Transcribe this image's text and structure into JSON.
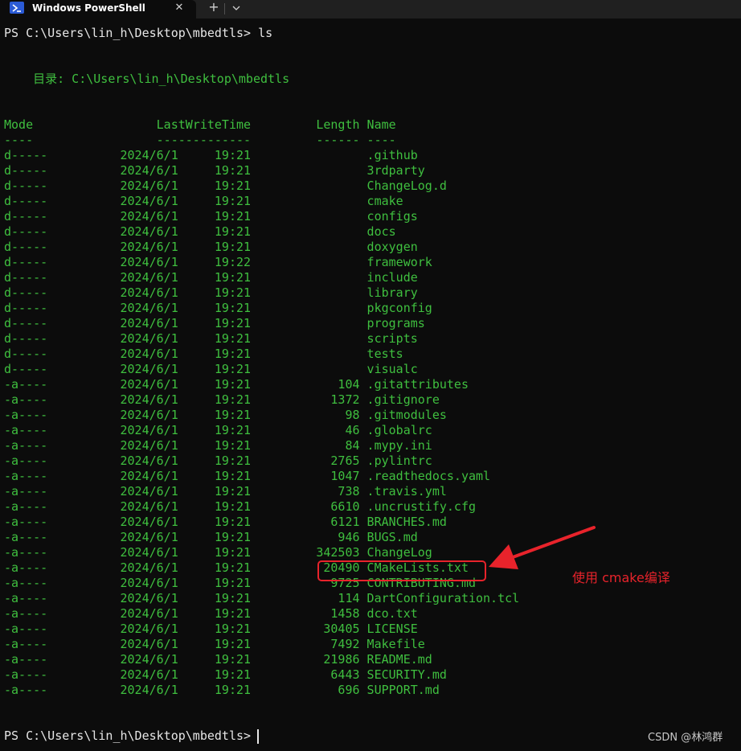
{
  "tab": {
    "title": "Windows PowerShell",
    "close_glyph": "✕",
    "new_tab_glyph": "+",
    "icon": "powershell-icon",
    "dropdown_icon": "chevron-down-icon"
  },
  "terminal": {
    "prompt1": "PS C:\\Users\\lin_h\\Desktop\\mbedtls> ls",
    "directory_line": "    目录: C:\\Users\\lin_h\\Desktop\\mbedtls",
    "header": "Mode                 LastWriteTime         Length Name",
    "header_underline": "----                 -------------         ------ ----",
    "entries": [
      "d-----          2024/6/1     19:21                .github",
      "d-----          2024/6/1     19:21                3rdparty",
      "d-----          2024/6/1     19:21                ChangeLog.d",
      "d-----          2024/6/1     19:21                cmake",
      "d-----          2024/6/1     19:21                configs",
      "d-----          2024/6/1     19:21                docs",
      "d-----          2024/6/1     19:21                doxygen",
      "d-----          2024/6/1     19:22                framework",
      "d-----          2024/6/1     19:21                include",
      "d-----          2024/6/1     19:21                library",
      "d-----          2024/6/1     19:21                pkgconfig",
      "d-----          2024/6/1     19:21                programs",
      "d-----          2024/6/1     19:21                scripts",
      "d-----          2024/6/1     19:21                tests",
      "d-----          2024/6/1     19:21                visualc",
      "-a----          2024/6/1     19:21            104 .gitattributes",
      "-a----          2024/6/1     19:21           1372 .gitignore",
      "-a----          2024/6/1     19:21             98 .gitmodules",
      "-a----          2024/6/1     19:21             46 .globalrc",
      "-a----          2024/6/1     19:21             84 .mypy.ini",
      "-a----          2024/6/1     19:21           2765 .pylintrc",
      "-a----          2024/6/1     19:21           1047 .readthedocs.yaml",
      "-a----          2024/6/1     19:21            738 .travis.yml",
      "-a----          2024/6/1     19:21           6610 .uncrustify.cfg",
      "-a----          2024/6/1     19:21           6121 BRANCHES.md",
      "-a----          2024/6/1     19:21            946 BUGS.md",
      "-a----          2024/6/1     19:21         342503 ChangeLog",
      "-a----          2024/6/1     19:21          20490 CMakeLists.txt",
      "-a----          2024/6/1     19:21           9725 CONTRIBUTING.md",
      "-a----          2024/6/1     19:21            114 DartConfiguration.tcl",
      "-a----          2024/6/1     19:21           1458 dco.txt",
      "-a----          2024/6/1     19:21          30405 LICENSE",
      "-a----          2024/6/1     19:21           7492 Makefile",
      "-a----          2024/6/1     19:21          21986 README.md",
      "-a----          2024/6/1     19:21           6443 SECURITY.md",
      "-a----          2024/6/1     19:21            696 SUPPORT.md"
    ],
    "prompt2": "PS C:\\Users\\lin_h\\Desktop\\mbedtls> "
  },
  "annotation": {
    "text": "使用 cmake编译",
    "color": "#e8232b"
  },
  "watermark": "CSDN @林鸿群",
  "colors": {
    "background": "#0c0c0c",
    "text_green": "#3fbf3f",
    "prompt": "#e6e6e6",
    "accent_red": "#e8232b"
  }
}
